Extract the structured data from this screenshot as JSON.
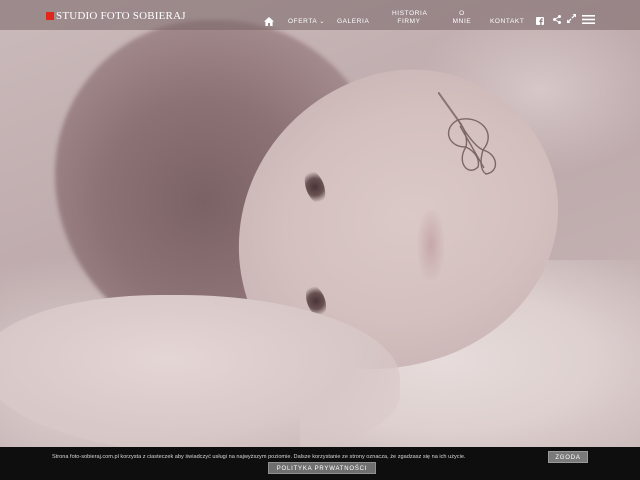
{
  "brand": {
    "logo_text": "STUDIO FOTO SOBIERAJ",
    "logo_color": "#e1261c"
  },
  "nav": {
    "home_icon": "home-icon",
    "items": [
      {
        "label": "OFERTA",
        "has_dropdown": true
      },
      {
        "label": "GALERIA"
      },
      {
        "label": "HISTORIA",
        "label2": "FIRMY"
      },
      {
        "label": "O",
        "label2": "MNIE"
      },
      {
        "label": "KONTAKT"
      }
    ],
    "icons": [
      "facebook-icon",
      "share-icon",
      "fullscreen-icon",
      "menu-icon"
    ]
  },
  "cookie": {
    "message": "Strona foto-sobieraj.com.pl korzysta z ciasteczek aby świadczyć usługi na najwyższym poziomie. Dalsze korzystanie ze strony oznacza, że zgadzasz się na ich użycie.",
    "accept_label": "ZGODA",
    "privacy_label": "POLITYKA PRYWATNOŚCI"
  }
}
